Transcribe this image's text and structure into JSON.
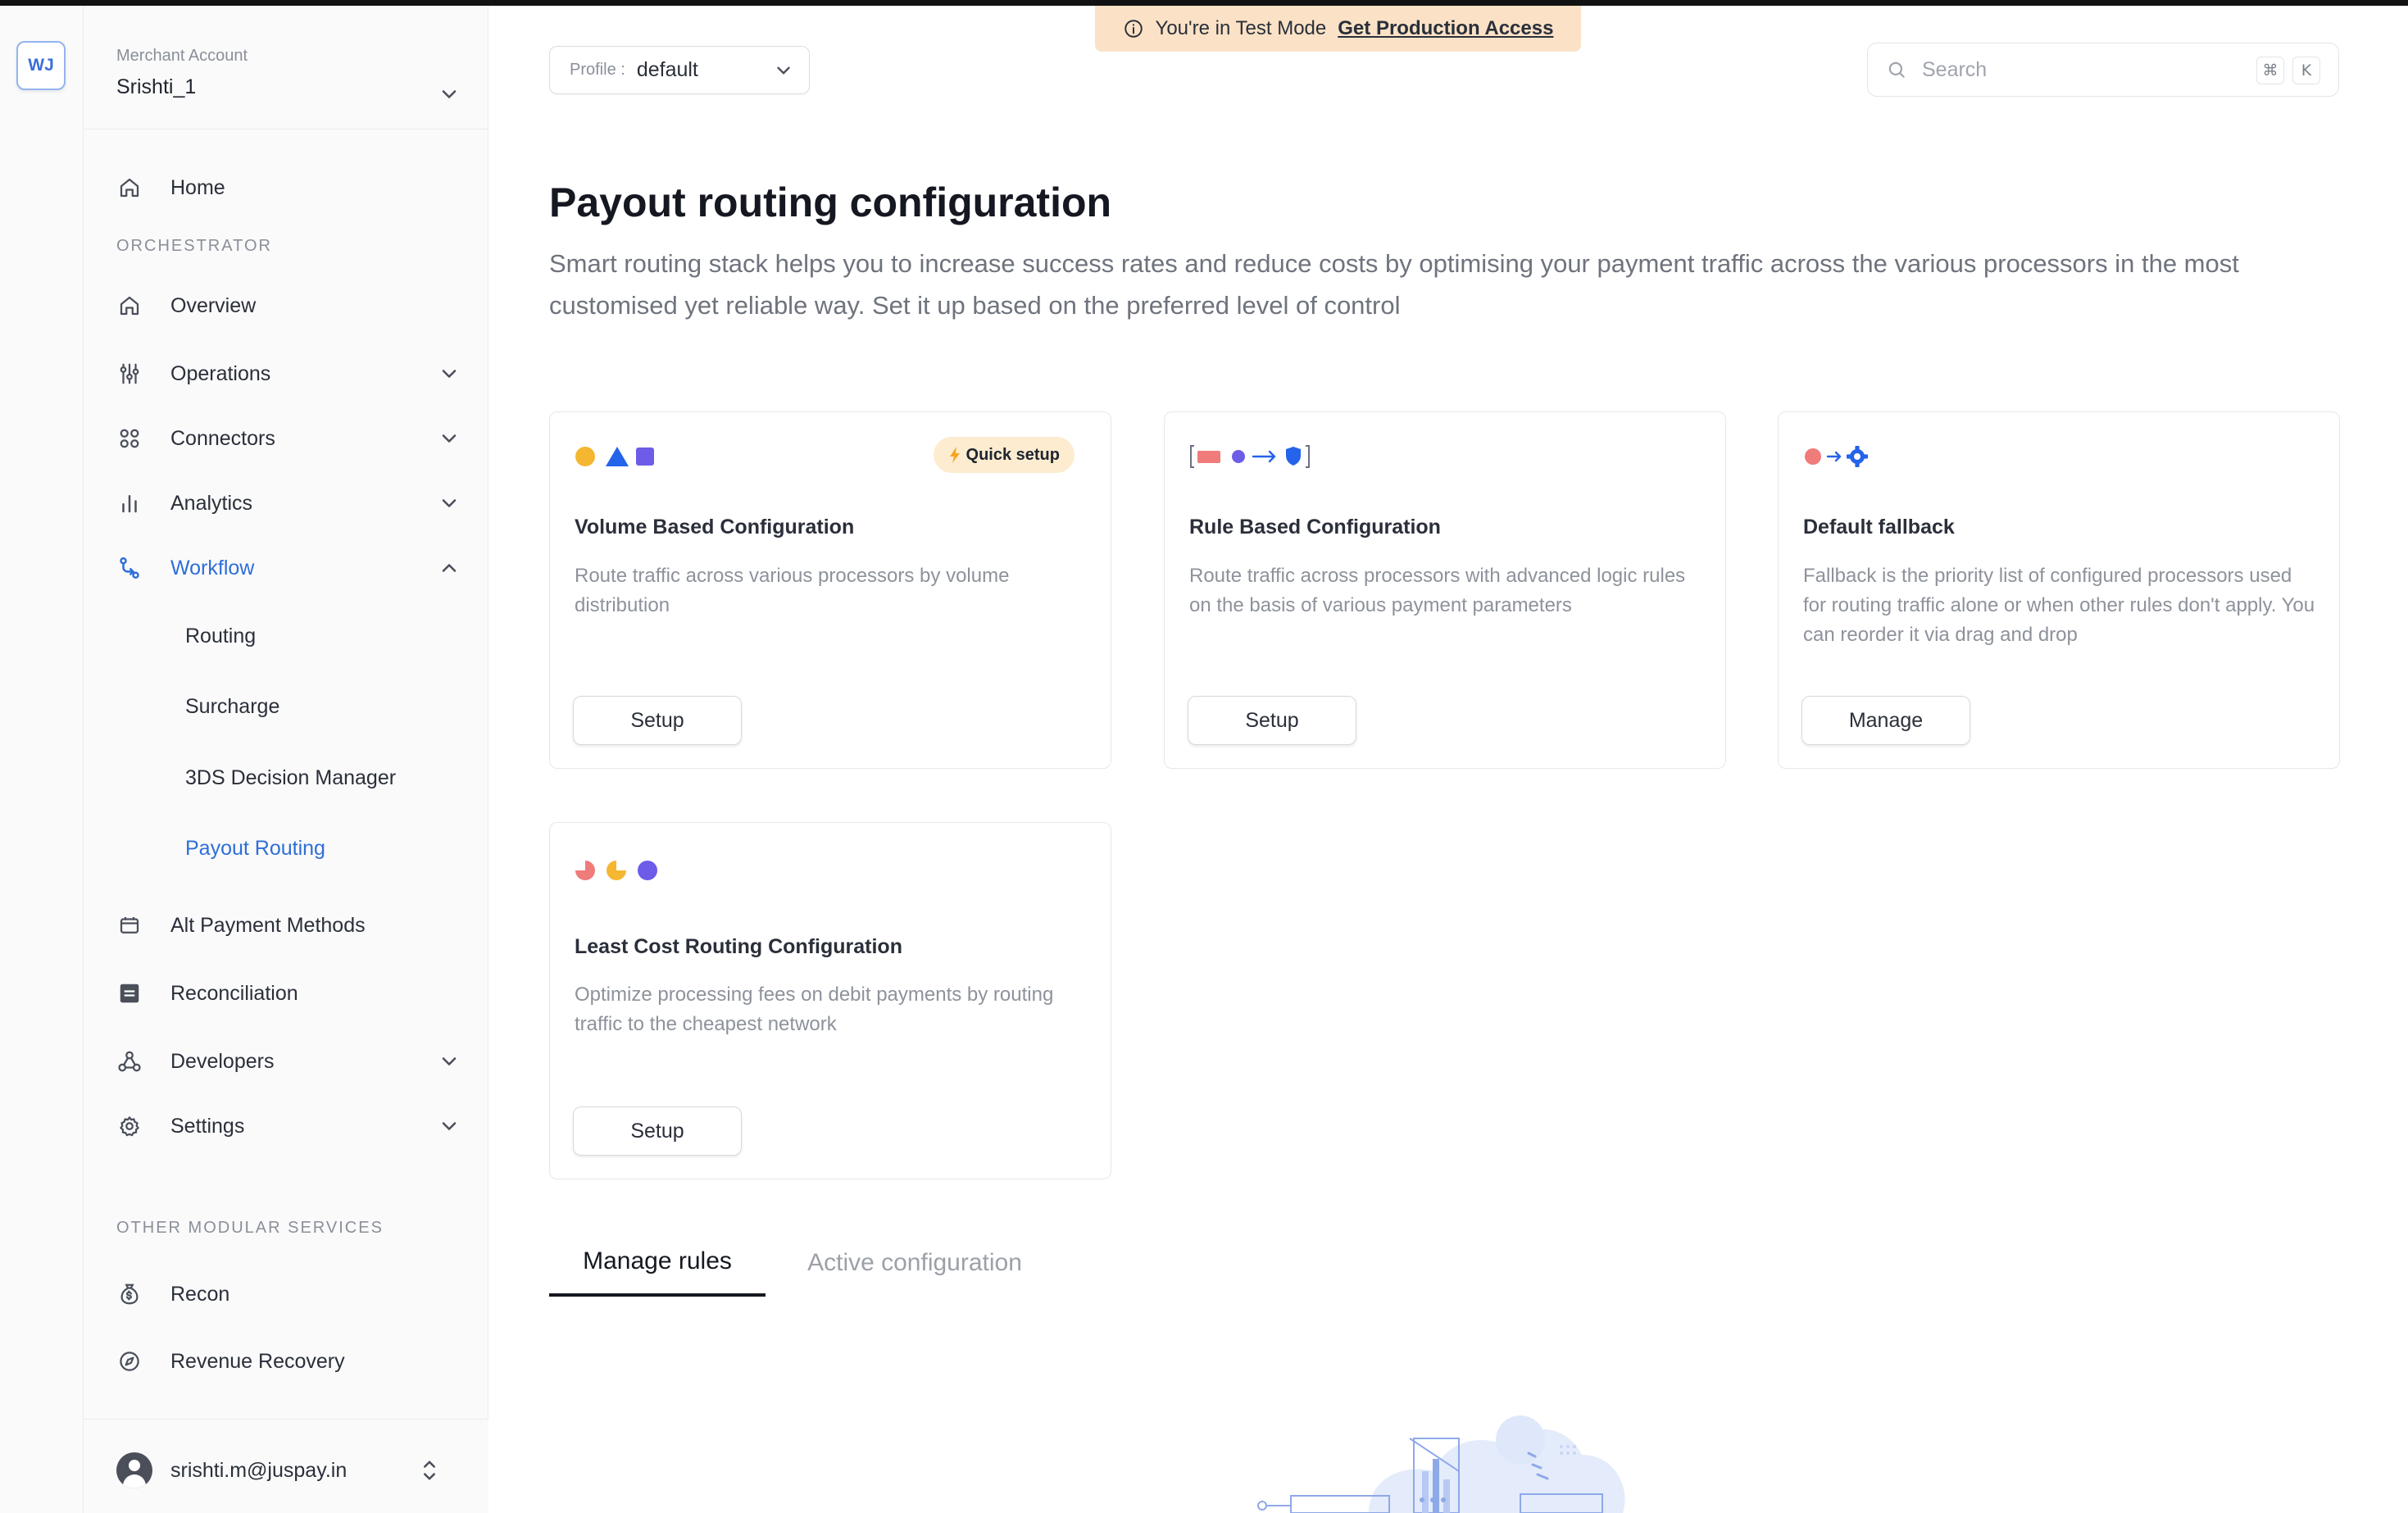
{
  "rail": {
    "badge": "WJ"
  },
  "merchant": {
    "label": "Merchant Account",
    "name": "Srishti_1"
  },
  "sidebar": {
    "home": "Home",
    "orchestrator_heading": "ORCHESTRATOR",
    "items": {
      "overview": "Overview",
      "operations": "Operations",
      "connectors": "Connectors",
      "analytics": "Analytics",
      "workflow": "Workflow",
      "alt_payment": "Alt Payment Methods",
      "reconciliation": "Reconciliation",
      "developers": "Developers",
      "settings": "Settings"
    },
    "workflow_sub": {
      "routing": "Routing",
      "surcharge": "Surcharge",
      "threeds": "3DS Decision Manager",
      "payout_routing": "Payout Routing"
    },
    "other_heading": "OTHER MODULAR SERVICES",
    "other": {
      "recon": "Recon",
      "revenue_recovery": "Revenue Recovery"
    },
    "user_email": "srishti.m@juspay.in"
  },
  "banner": {
    "text": "You're in Test Mode",
    "link": "Get Production Access"
  },
  "profile": {
    "label": "Profile :",
    "value": "default"
  },
  "search": {
    "placeholder": "Search",
    "key1": "⌘",
    "key2": "K"
  },
  "page": {
    "title": "Payout routing configuration",
    "description": "Smart routing stack helps you to increase success rates and reduce costs by optimising your payment traffic across the various processors in the most customised yet reliable way. Set it up based on the preferred level of control"
  },
  "cards": {
    "volume": {
      "title": "Volume Based Configuration",
      "description": "Route traffic across various processors by volume distribution",
      "button": "Setup",
      "badge": "Quick setup"
    },
    "rule": {
      "title": "Rule Based Configuration",
      "description": "Route traffic across processors with advanced logic rules on the basis of various payment parameters",
      "button": "Setup"
    },
    "fallback": {
      "title": "Default fallback",
      "description": "Fallback is the priority list of configured processors used for routing traffic alone or when other rules don't apply. You can reorder it via drag and drop",
      "button": "Manage"
    },
    "leastcost": {
      "title": "Least Cost Routing Configuration",
      "description": "Optimize processing fees on debit payments by routing traffic to the cheapest network",
      "button": "Setup"
    }
  },
  "tabs": {
    "manage": "Manage rules",
    "active": "Active configuration"
  },
  "colors": {
    "accent": "#2e6ed8",
    "banner_bg": "#fbe2c6",
    "badge_bg": "#fdeccf",
    "yellow": "#f5b731",
    "blue": "#2563eb",
    "purple": "#6d5ce8",
    "coral": "#ef7b7b"
  }
}
